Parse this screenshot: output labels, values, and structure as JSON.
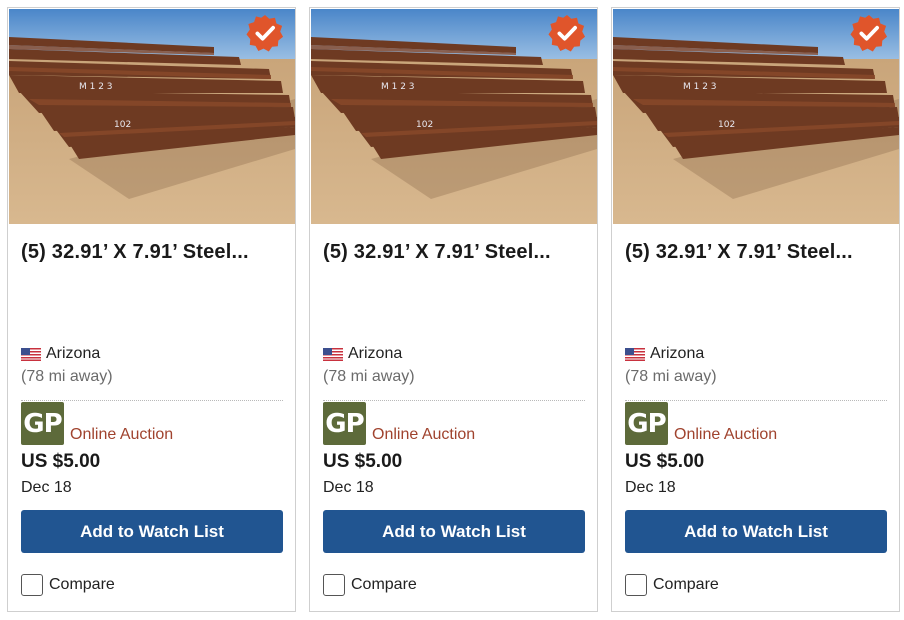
{
  "listings": [
    {
      "title": "(5) 32.91’ X 7.91’ Steel...",
      "location": "Arizona",
      "flag_icon": "us-flag-icon",
      "distance": "(78 mi away)",
      "seller_logo_text": "GP",
      "sale_type": "Online Auction",
      "price": "US $5.00",
      "date": "Dec 18",
      "watch_button_label": "Add to Watch List",
      "compare_label": "Compare",
      "badge_icon": "verified-check-badge-icon"
    },
    {
      "title": "(5) 32.91’ X 7.91’ Steel...",
      "location": "Arizona",
      "flag_icon": "us-flag-icon",
      "distance": "(78 mi away)",
      "seller_logo_text": "GP",
      "sale_type": "Online Auction",
      "price": "US $5.00",
      "date": "Dec 18",
      "watch_button_label": "Add to Watch List",
      "compare_label": "Compare",
      "badge_icon": "verified-check-badge-icon"
    },
    {
      "title": "(5) 32.91’ X 7.91’ Steel...",
      "location": "Arizona",
      "flag_icon": "us-flag-icon",
      "distance": "(78 mi away)",
      "seller_logo_text": "GP",
      "sale_type": "Online Auction",
      "price": "US $5.00",
      "date": "Dec 18",
      "watch_button_label": "Add to Watch List",
      "compare_label": "Compare",
      "badge_icon": "verified-check-badge-icon"
    }
  ],
  "colors": {
    "button_blue": "#215591",
    "auction_red": "#a0432e",
    "badge_orange": "#e0552b",
    "seller_logo_green": "#5d6a3a"
  }
}
